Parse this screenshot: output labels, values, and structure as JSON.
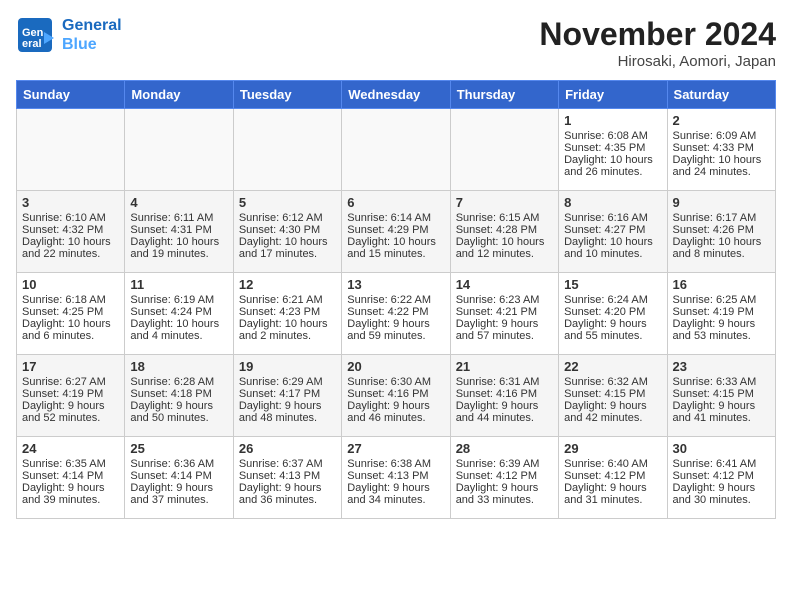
{
  "header": {
    "logo_line1": "General",
    "logo_line2": "Blue",
    "title": "November 2024",
    "subtitle": "Hirosaki, Aomori, Japan"
  },
  "days_of_week": [
    "Sunday",
    "Monday",
    "Tuesday",
    "Wednesday",
    "Thursday",
    "Friday",
    "Saturday"
  ],
  "weeks": [
    [
      {
        "day": "",
        "sunrise": "",
        "sunset": "",
        "daylight": ""
      },
      {
        "day": "",
        "sunrise": "",
        "sunset": "",
        "daylight": ""
      },
      {
        "day": "",
        "sunrise": "",
        "sunset": "",
        "daylight": ""
      },
      {
        "day": "",
        "sunrise": "",
        "sunset": "",
        "daylight": ""
      },
      {
        "day": "",
        "sunrise": "",
        "sunset": "",
        "daylight": ""
      },
      {
        "day": "1",
        "sunrise": "Sunrise: 6:08 AM",
        "sunset": "Sunset: 4:35 PM",
        "daylight": "Daylight: 10 hours and 26 minutes."
      },
      {
        "day": "2",
        "sunrise": "Sunrise: 6:09 AM",
        "sunset": "Sunset: 4:33 PM",
        "daylight": "Daylight: 10 hours and 24 minutes."
      }
    ],
    [
      {
        "day": "3",
        "sunrise": "Sunrise: 6:10 AM",
        "sunset": "Sunset: 4:32 PM",
        "daylight": "Daylight: 10 hours and 22 minutes."
      },
      {
        "day": "4",
        "sunrise": "Sunrise: 6:11 AM",
        "sunset": "Sunset: 4:31 PM",
        "daylight": "Daylight: 10 hours and 19 minutes."
      },
      {
        "day": "5",
        "sunrise": "Sunrise: 6:12 AM",
        "sunset": "Sunset: 4:30 PM",
        "daylight": "Daylight: 10 hours and 17 minutes."
      },
      {
        "day": "6",
        "sunrise": "Sunrise: 6:14 AM",
        "sunset": "Sunset: 4:29 PM",
        "daylight": "Daylight: 10 hours and 15 minutes."
      },
      {
        "day": "7",
        "sunrise": "Sunrise: 6:15 AM",
        "sunset": "Sunset: 4:28 PM",
        "daylight": "Daylight: 10 hours and 12 minutes."
      },
      {
        "day": "8",
        "sunrise": "Sunrise: 6:16 AM",
        "sunset": "Sunset: 4:27 PM",
        "daylight": "Daylight: 10 hours and 10 minutes."
      },
      {
        "day": "9",
        "sunrise": "Sunrise: 6:17 AM",
        "sunset": "Sunset: 4:26 PM",
        "daylight": "Daylight: 10 hours and 8 minutes."
      }
    ],
    [
      {
        "day": "10",
        "sunrise": "Sunrise: 6:18 AM",
        "sunset": "Sunset: 4:25 PM",
        "daylight": "Daylight: 10 hours and 6 minutes."
      },
      {
        "day": "11",
        "sunrise": "Sunrise: 6:19 AM",
        "sunset": "Sunset: 4:24 PM",
        "daylight": "Daylight: 10 hours and 4 minutes."
      },
      {
        "day": "12",
        "sunrise": "Sunrise: 6:21 AM",
        "sunset": "Sunset: 4:23 PM",
        "daylight": "Daylight: 10 hours and 2 minutes."
      },
      {
        "day": "13",
        "sunrise": "Sunrise: 6:22 AM",
        "sunset": "Sunset: 4:22 PM",
        "daylight": "Daylight: 9 hours and 59 minutes."
      },
      {
        "day": "14",
        "sunrise": "Sunrise: 6:23 AM",
        "sunset": "Sunset: 4:21 PM",
        "daylight": "Daylight: 9 hours and 57 minutes."
      },
      {
        "day": "15",
        "sunrise": "Sunrise: 6:24 AM",
        "sunset": "Sunset: 4:20 PM",
        "daylight": "Daylight: 9 hours and 55 minutes."
      },
      {
        "day": "16",
        "sunrise": "Sunrise: 6:25 AM",
        "sunset": "Sunset: 4:19 PM",
        "daylight": "Daylight: 9 hours and 53 minutes."
      }
    ],
    [
      {
        "day": "17",
        "sunrise": "Sunrise: 6:27 AM",
        "sunset": "Sunset: 4:19 PM",
        "daylight": "Daylight: 9 hours and 52 minutes."
      },
      {
        "day": "18",
        "sunrise": "Sunrise: 6:28 AM",
        "sunset": "Sunset: 4:18 PM",
        "daylight": "Daylight: 9 hours and 50 minutes."
      },
      {
        "day": "19",
        "sunrise": "Sunrise: 6:29 AM",
        "sunset": "Sunset: 4:17 PM",
        "daylight": "Daylight: 9 hours and 48 minutes."
      },
      {
        "day": "20",
        "sunrise": "Sunrise: 6:30 AM",
        "sunset": "Sunset: 4:16 PM",
        "daylight": "Daylight: 9 hours and 46 minutes."
      },
      {
        "day": "21",
        "sunrise": "Sunrise: 6:31 AM",
        "sunset": "Sunset: 4:16 PM",
        "daylight": "Daylight: 9 hours and 44 minutes."
      },
      {
        "day": "22",
        "sunrise": "Sunrise: 6:32 AM",
        "sunset": "Sunset: 4:15 PM",
        "daylight": "Daylight: 9 hours and 42 minutes."
      },
      {
        "day": "23",
        "sunrise": "Sunrise: 6:33 AM",
        "sunset": "Sunset: 4:15 PM",
        "daylight": "Daylight: 9 hours and 41 minutes."
      }
    ],
    [
      {
        "day": "24",
        "sunrise": "Sunrise: 6:35 AM",
        "sunset": "Sunset: 4:14 PM",
        "daylight": "Daylight: 9 hours and 39 minutes."
      },
      {
        "day": "25",
        "sunrise": "Sunrise: 6:36 AM",
        "sunset": "Sunset: 4:14 PM",
        "daylight": "Daylight: 9 hours and 37 minutes."
      },
      {
        "day": "26",
        "sunrise": "Sunrise: 6:37 AM",
        "sunset": "Sunset: 4:13 PM",
        "daylight": "Daylight: 9 hours and 36 minutes."
      },
      {
        "day": "27",
        "sunrise": "Sunrise: 6:38 AM",
        "sunset": "Sunset: 4:13 PM",
        "daylight": "Daylight: 9 hours and 34 minutes."
      },
      {
        "day": "28",
        "sunrise": "Sunrise: 6:39 AM",
        "sunset": "Sunset: 4:12 PM",
        "daylight": "Daylight: 9 hours and 33 minutes."
      },
      {
        "day": "29",
        "sunrise": "Sunrise: 6:40 AM",
        "sunset": "Sunset: 4:12 PM",
        "daylight": "Daylight: 9 hours and 31 minutes."
      },
      {
        "day": "30",
        "sunrise": "Sunrise: 6:41 AM",
        "sunset": "Sunset: 4:12 PM",
        "daylight": "Daylight: 9 hours and 30 minutes."
      }
    ]
  ]
}
